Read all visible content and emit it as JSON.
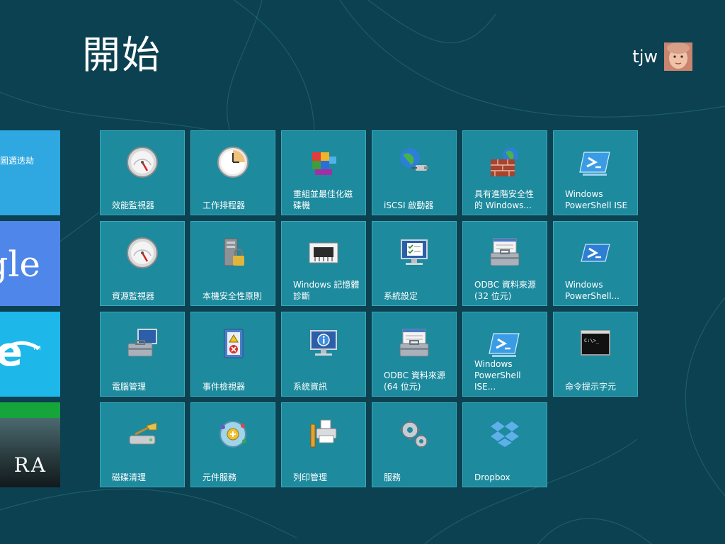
{
  "header": {
    "title": "開始",
    "user_name": "tjw"
  },
  "left_tiles": [
    {
      "label": "圖邁迭劫"
    },
    {
      "label": "gle"
    },
    {
      "label": "e"
    },
    {
      "label": "RA"
    }
  ],
  "tiles": [
    {
      "label": "效能監視器",
      "icon": "gauge-icon"
    },
    {
      "label": "工作排程器",
      "icon": "clock-icon"
    },
    {
      "label": "重組並最佳化磁\n碟機",
      "icon": "defrag-blocks-icon"
    },
    {
      "label": "iSCSI 啟動器",
      "icon": "globe-plug-icon"
    },
    {
      "label": "具有進階安全性\n的 Windows...",
      "icon": "firewall-globe-icon"
    },
    {
      "label": "Windows\nPowerShell ISE",
      "icon": "powershell-ise-icon"
    },
    {
      "label": "資源監視器",
      "icon": "gauge-icon"
    },
    {
      "label": "本機安全性原則",
      "icon": "server-lock-icon"
    },
    {
      "label": "Windows 記憶體\n診斷",
      "icon": "memory-chip-icon"
    },
    {
      "label": "系統設定",
      "icon": "monitor-checklist-icon"
    },
    {
      "label": "ODBC 資料來源\n(32 位元)",
      "icon": "database-toolbox-icon"
    },
    {
      "label": "Windows\nPowerShell...",
      "icon": "powershell-icon"
    },
    {
      "label": "電腦管理",
      "icon": "computer-toolbox-icon"
    },
    {
      "label": "事件檢視器",
      "icon": "event-log-book-icon"
    },
    {
      "label": "系統資訊",
      "icon": "monitor-info-icon"
    },
    {
      "label": "ODBC 資料來源\n(64 位元)",
      "icon": "database-toolbox-icon"
    },
    {
      "label": "Windows\nPowerShell ISE...",
      "icon": "powershell-ise-icon"
    },
    {
      "label": "命令提示字元",
      "icon": "command-prompt-icon"
    },
    {
      "label": "磁碟清理",
      "icon": "disk-cleanup-icon"
    },
    {
      "label": "元件服務",
      "icon": "component-services-icon"
    },
    {
      "label": "列印管理",
      "icon": "print-management-icon"
    },
    {
      "label": "服務",
      "icon": "gears-icon"
    },
    {
      "label": "Dropbox",
      "icon": "dropbox-icon"
    }
  ],
  "colors": {
    "background": "#0b4150",
    "tile": "#1d8a9e",
    "tile_border": "#3aa8bb"
  }
}
